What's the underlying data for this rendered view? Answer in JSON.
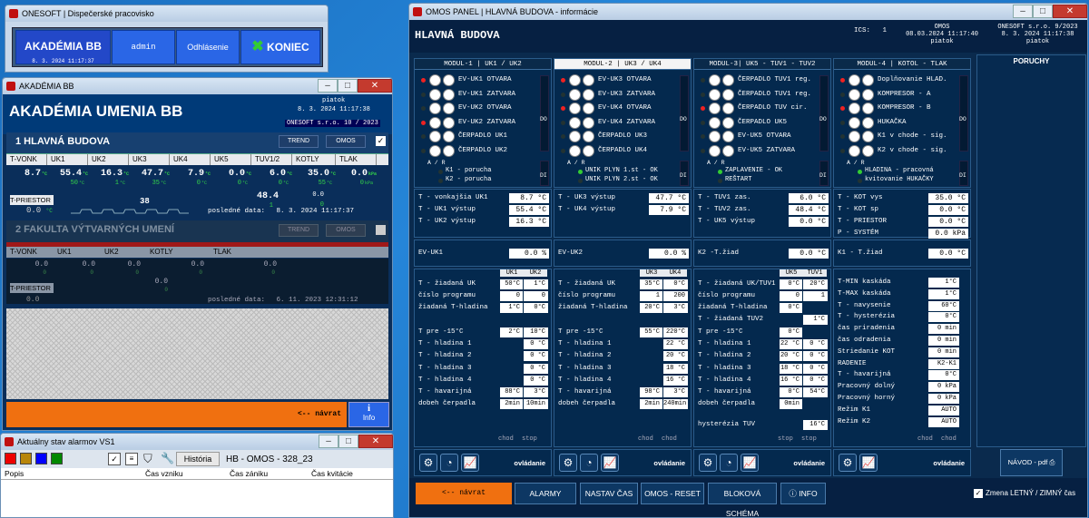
{
  "win_top": {
    "title": "ONESOFT | Dispečerské pracovisko",
    "akademia_btn": "AKADÉMIA BB",
    "date": "8. 3. 2024 11:17:37",
    "admin": "admin",
    "odhlasenie": "Odhlásenie",
    "koniec": "KONIEC"
  },
  "win_ak": {
    "title": "AKADÉMIA BB",
    "header": "AKADÉMIA UMENIA BB",
    "day": "piatok",
    "datetime": "8. 3. 2024 11:17:38",
    "company": "ONESOFT s.r.o. 10 / 2023",
    "section1": "1  HLAVNÁ BUDOVA",
    "trend": "TREND",
    "omos": "OMOS",
    "cols1": [
      "T-VONK",
      "UK1",
      "UK2",
      "UK3",
      "UK4",
      "UK5",
      "TUV1/2",
      "KOTLY",
      "TLAK"
    ],
    "row1_vals": [
      "8.7",
      "55.4",
      "16.3",
      "47.7",
      "7.9",
      "0.0",
      "6.0",
      "35.0",
      "0.0"
    ],
    "row1_unit": [
      "°C",
      "°C",
      "°C",
      "°C",
      "°C",
      "°C",
      "°C",
      "°C",
      "kPa"
    ],
    "row1_sub": [
      "",
      "50",
      "1",
      "35",
      "0",
      "0",
      "0",
      "55",
      "0"
    ],
    "row1_sub_unit": [
      "",
      "°C",
      "°C",
      "°C",
      "°C",
      "°C",
      "°C",
      "°C",
      "kPa"
    ],
    "tuv2_val": "48.4",
    "tuv2_sub": "1",
    "kotly_sub2": "0.0",
    "kotly_sub3": "0",
    "tpriestor": "T-PRIESTOR",
    "tpriestor_val": "0.0",
    "tpriestor_unit": "°C",
    "mid_val": "38",
    "last_data_label": "posledné data:",
    "last_data1": "8. 3. 2024 11:17:37",
    "section2": "2  FAKULTA VÝTVARNÝCH UMENÍ",
    "trend2": "TREND",
    "omos2": "OMOS",
    "cols2": [
      "T-VONK",
      "UK1",
      "UK2",
      "KOTLY",
      "TLAK"
    ],
    "row2_vals": [
      "0.0",
      "0.0",
      "0.0",
      "0.0",
      "0.0"
    ],
    "row2_sub": [
      "0",
      "0",
      "0",
      "0",
      "0"
    ],
    "kotly2_b": "0.0",
    "kotly2_c": "0",
    "tpriestor2": "T-PRIESTOR",
    "tpriestor2_val": "0.0",
    "last_data2": "6. 11. 2023 12:31:12",
    "back": "<--   návrat",
    "info": "Info"
  },
  "win_alarm": {
    "title": "Aktuálny stav alarmov VS1",
    "historia": "História",
    "ref": "HB - OMOS - 328_23",
    "cols": [
      "Popis",
      "Čas vzniku",
      "Čas zániku",
      "Čas kvitácie"
    ]
  },
  "omos": {
    "title": "OMOS PANEL | HLAVNÁ BUDOVA - informácie",
    "header": "HLAVNÁ BUDOVA",
    "ics_label": "ICS:",
    "ics_val": "1",
    "omos_label": "OMOS",
    "omos_dt": "08.03.2024 11:17:40",
    "omos_day": "piatok",
    "co_label": "ONESOFT s.r.o. 9/2023",
    "co_dt": "8. 3. 2024 11:17:38",
    "co_day": "piatok",
    "poruchy": "PORUCHY",
    "modules": [
      {
        "head": "MODUL-1  |  UK1 / UK2",
        "sel": false,
        "items": [
          "EV-UK1 OTVARA",
          "EV-UK1 ZATVARA",
          "EV-UK2 OTVARA",
          "EV-UK2 ZATVARA",
          "ČERPADLO UK1",
          "ČERPADLO UK2"
        ],
        "leds": [
          1,
          0,
          0,
          1,
          0,
          0
        ],
        "di": [
          "K1 - porucha",
          "K2 - porucha"
        ],
        "di_g": [
          0,
          0
        ]
      },
      {
        "head": "MODUL-2  |  UK3 / UK4",
        "sel": true,
        "items": [
          "EV-UK3 OTVARA",
          "EV-UK3 ZATVARA",
          "EV-UK4 OTVARA",
          "EV-UK4 ZATVARA",
          "ČERPADLO UK3",
          "ČERPADLO UK4"
        ],
        "leds": [
          1,
          0,
          1,
          0,
          0,
          0
        ],
        "di": [
          "UNIK PLYN 1.st - OK",
          "UNIK PLYN 2.st - OK"
        ],
        "di_g": [
          1,
          0
        ]
      },
      {
        "head": "MODUL-3|  UK5 - TUV1 - TUV2",
        "sel": false,
        "items": [
          "ČERPADLO TUV1 reg.",
          "ČERPADLO TUV1 reg.",
          "ČERPADLO TUV cir.",
          "ČERPADLO UK5",
          "EV-UK5 OTVARA",
          "EV-UK5 ZATVARA"
        ],
        "leds": [
          0,
          0,
          1,
          0,
          0,
          0
        ],
        "di": [
          "ZAPLAVENIE - OK",
          "REŠTART"
        ],
        "di_g": [
          1,
          0
        ]
      },
      {
        "head": "MODUL-4  |  KOTOL - TLAK",
        "sel": false,
        "items": [
          "Doplňovanie HLAD.",
          "KOMPRESOR - A",
          "KOMPRESOR - B",
          "HUKAČKA",
          "K1 v chode - sig.",
          "K2 v chode - sig."
        ],
        "leds": [
          1,
          0,
          1,
          0,
          0,
          0
        ],
        "di": [
          "HLADINA - pracovná",
          "kvitovanie HUKAČKY"
        ],
        "di_g": [
          1,
          0
        ]
      }
    ],
    "ar": "A  /  R",
    "do": "DO",
    "di_lbl": "DI",
    "m1": {
      "temps": [
        [
          "T - vonkajšia UK1",
          "8.7",
          "°C"
        ],
        [
          "T - UK1 výstup",
          "55.4",
          "°C"
        ],
        [
          "T - UK2 výstup",
          "16.3",
          "°C"
        ]
      ],
      "ev": [
        "EV-UK1",
        "0.0",
        "%"
      ],
      "colh": [
        "UK1",
        "UK2"
      ],
      "p1": [
        [
          "T - žiadaná UK",
          "50°C",
          "1°C"
        ],
        [
          "číslo programu",
          "0",
          "0"
        ],
        [
          "žiadaná T-hladina",
          "1°C",
          "0°C"
        ]
      ],
      "p2": [
        [
          "T pre -15°C",
          "2°C",
          "10°C"
        ],
        [
          "T - hladina 1",
          "",
          "0 °C"
        ],
        [
          "T - hladina 2",
          "",
          "0 °C"
        ],
        [
          "T - hladina 3",
          "",
          "0 °C"
        ],
        [
          "T - hladina 4",
          "",
          "0 °C"
        ],
        [
          "T - havarijná",
          "88°C",
          "3°C"
        ],
        [
          "dobeh čerpadla",
          "2min",
          "10min"
        ]
      ],
      "foot": [
        "chod",
        "stop"
      ]
    },
    "m2": {
      "temps": [
        [
          "T - UK3 výstup",
          "47.7",
          "°C"
        ],
        [
          "T - UK4 výstup",
          "7.9",
          "°C"
        ]
      ],
      "ev": [
        "EV-UK2",
        "0.0",
        "%"
      ],
      "colh": [
        "UK3",
        "UK4"
      ],
      "p1": [
        [
          "T - žiadaná UK",
          "35°C",
          "0°C"
        ],
        [
          "číslo programu",
          "1",
          "200"
        ],
        [
          "žiadaná T-hladina",
          "20°C",
          "3°C"
        ]
      ],
      "p2": [
        [
          "T pre -15°C",
          "55°C",
          "220°C"
        ],
        [
          "T - hladina 1",
          "",
          "22 °C"
        ],
        [
          "T - hladina 2",
          "",
          "20 °C"
        ],
        [
          "T - hladina 3",
          "",
          "18 °C"
        ],
        [
          "T - hladina 4",
          "",
          "16 °C"
        ],
        [
          "T - havarijná",
          "98°C",
          "3°C"
        ],
        [
          "dobeh čerpadla",
          "2min",
          "240min"
        ]
      ],
      "foot": [
        "chod",
        "chod"
      ]
    },
    "m3": {
      "temps": [
        [
          "T - TUV1 zas.",
          "6.0",
          "°C"
        ],
        [
          "T - TUV2 zas.",
          "48.4",
          "°C"
        ],
        [
          "T - UK5 výstup",
          "0.0",
          "°C"
        ]
      ],
      "ev": [
        "K2 -T.žiad",
        "0.0",
        "°C"
      ],
      "colh": [
        "UK5",
        "TUV1"
      ],
      "p1": [
        [
          "T - žiadaná UK/TUV1",
          "0°C",
          "20°C"
        ],
        [
          "číslo programu",
          "0",
          "1"
        ],
        [
          "žiadaná T-hladina",
          "0°C",
          ""
        ],
        [
          "T - žiadaná TUV2",
          "",
          "1°C"
        ]
      ],
      "p2": [
        [
          "T pre -15°C",
          "0°C",
          ""
        ],
        [
          "T - hladina 1",
          "22 °C",
          "0 °C"
        ],
        [
          "T - hladina 2",
          "20 °C",
          "0 °C"
        ],
        [
          "T - hladina 3",
          "18 °C",
          "0 °C"
        ],
        [
          "T - hladina 4",
          "16 °C",
          "0 °C"
        ],
        [
          "T - havarijná",
          "0°C",
          "54°C"
        ],
        [
          "dobeh čerpadla",
          "0min",
          ""
        ]
      ],
      "hyst": [
        "hysterézia TUV",
        "16°C"
      ],
      "foot": [
        "stop",
        "stop"
      ]
    },
    "m4": {
      "temps": [
        [
          "T - KOT vys",
          "35.0",
          "°C"
        ],
        [
          "T - KOT sp",
          "0.0",
          "°C"
        ],
        [
          "T - PRIESTOR",
          "0.0",
          "°C"
        ],
        [
          "P - SYSTÉM",
          "0.0",
          "kPa"
        ]
      ],
      "ev": [
        "K1 - T.žiad",
        "0.0",
        "°C"
      ],
      "p": [
        [
          "T-MIN kaskáda",
          "1°C"
        ],
        [
          "T-MAX kaskáda",
          "1°C"
        ],
        [
          "T - navysenie",
          "60°C"
        ],
        [
          "T - hysterézia",
          "0°C"
        ],
        [
          "čas priradenia",
          "0 min"
        ],
        [
          "čas odradenia",
          "0 min"
        ],
        [
          "Striedanie KOT",
          "0 min"
        ],
        [
          "RADENIE",
          "K2-K1"
        ],
        [
          "T - havarijná",
          "0°C"
        ],
        [
          "Pracovný dolný",
          "0 kPa"
        ],
        [
          "Pracovný horný",
          "0 kPa"
        ],
        [
          "Režim K1",
          "AUTO"
        ],
        [
          "Režim K2",
          "AUTO"
        ]
      ],
      "foot": [
        "chod",
        "chod"
      ]
    },
    "ovladanie": "ovládanie",
    "navod": "NÁVOD - pdf",
    "bottom": {
      "back": "<--   návrat",
      "alarmy": "ALARMY",
      "nastav": "NASTAV ČAS",
      "reset": "OMOS - RESET",
      "blok": "BLOKOVÁ SCHÉMA",
      "info": "INFO",
      "zmena": "Zmena LETNÝ / ZIMNÝ čas"
    }
  }
}
